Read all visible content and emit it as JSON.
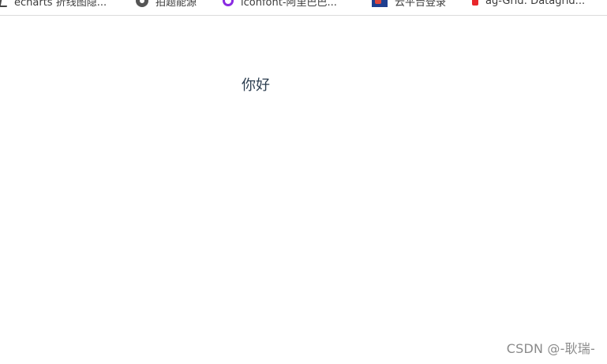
{
  "bookmarks": [
    {
      "label": "echarts 折线图隐...",
      "icon": "echarts-icon"
    },
    {
      "label": "拍题能源",
      "icon": "disc-icon"
    },
    {
      "label": "iconfont-阿里巴巴...",
      "icon": "iconfont-icon"
    },
    {
      "label": "云平台登录",
      "icon": "cloud-platform-icon"
    },
    {
      "label": "ag-Grid: Datagrid...",
      "icon": "ag-grid-icon"
    }
  ],
  "main": {
    "greeting": "你好"
  },
  "watermark": "CSDN @-耿瑞-"
}
